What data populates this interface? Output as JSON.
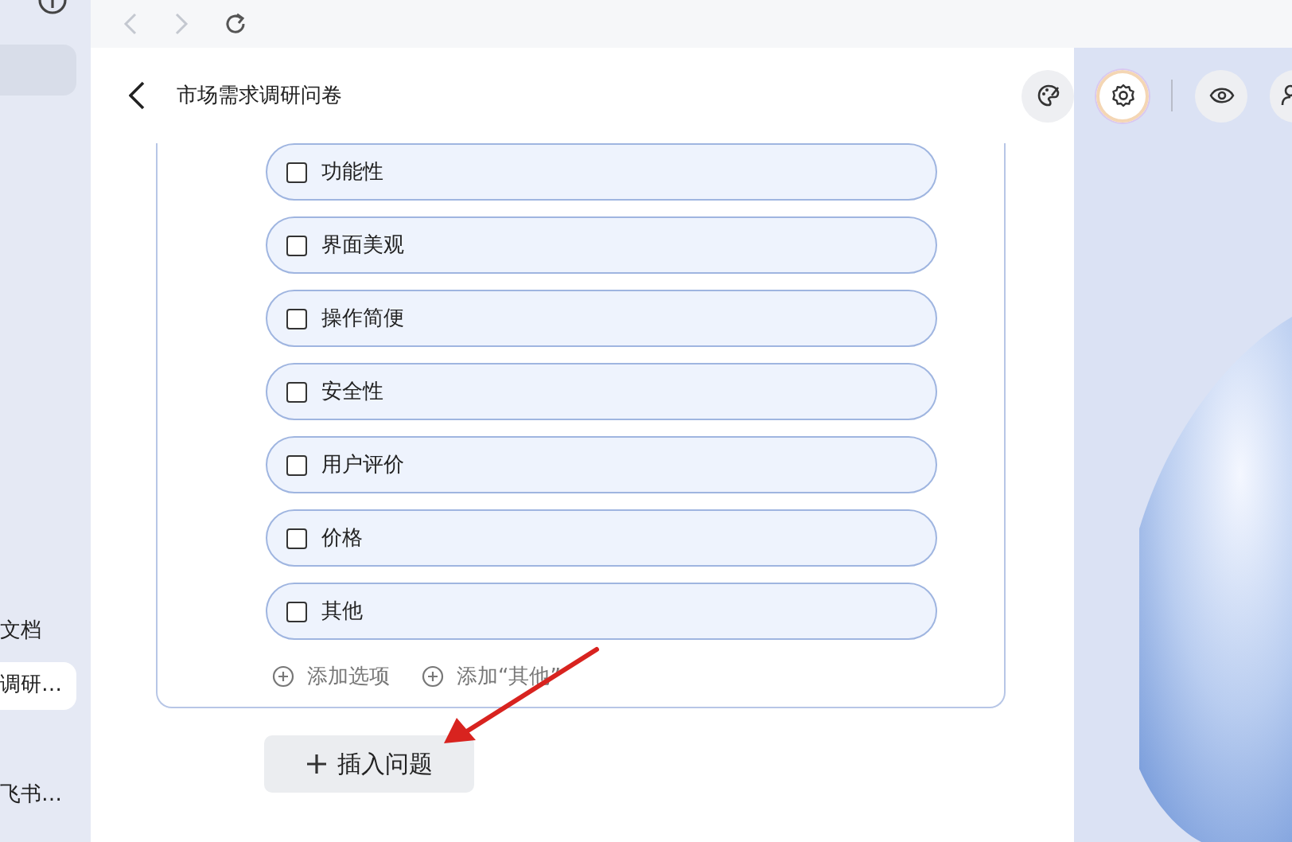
{
  "sidebar": {
    "items": [
      {
        "label": "文档",
        "selected": false
      },
      {
        "label": "调研…",
        "selected": true
      },
      {
        "label": "飞书…",
        "selected": false
      }
    ]
  },
  "header": {
    "title": "市场需求调研问卷"
  },
  "question": {
    "options": [
      {
        "label": "功能性",
        "checked": false
      },
      {
        "label": "界面美观",
        "checked": false
      },
      {
        "label": "操作简便",
        "checked": false
      },
      {
        "label": "安全性",
        "checked": false
      },
      {
        "label": "用户评价",
        "checked": false
      },
      {
        "label": "价格",
        "checked": false
      },
      {
        "label": "其他",
        "checked": false
      }
    ],
    "add_links": [
      "添加选项",
      "添加“其他”"
    ]
  },
  "insert_button": {
    "label": "插入问题"
  }
}
